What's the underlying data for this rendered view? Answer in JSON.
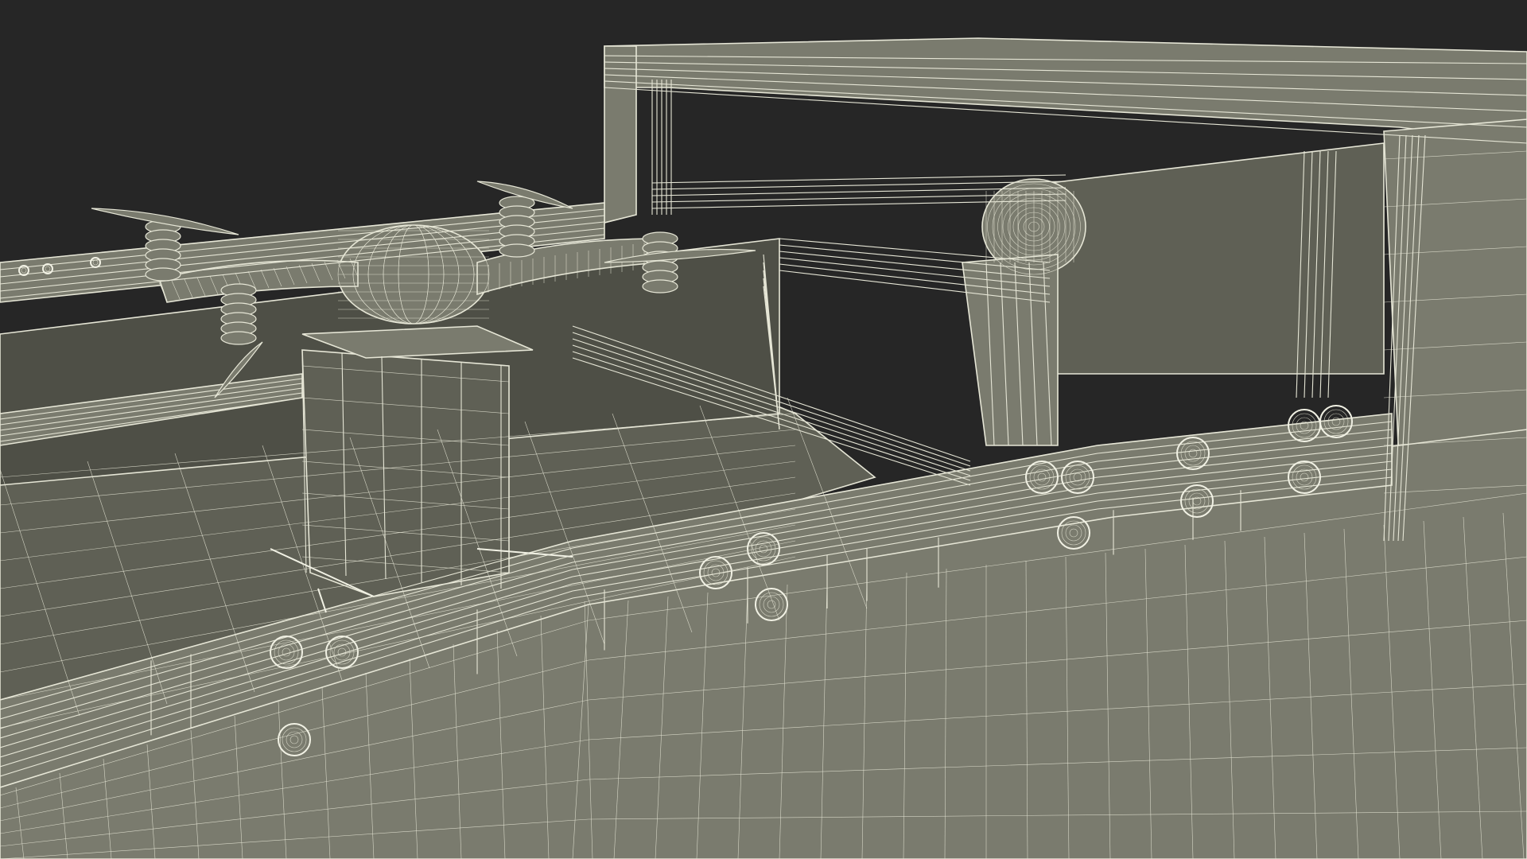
{
  "scene": {
    "subject": "drone-delivery-station-wireframe",
    "colors": {
      "background": "#262626",
      "surface": "#7a7b6e",
      "surface_dark": "#5f6055",
      "surface_shadow": "#4e4f46",
      "wire": "#e6e6d6"
    }
  }
}
